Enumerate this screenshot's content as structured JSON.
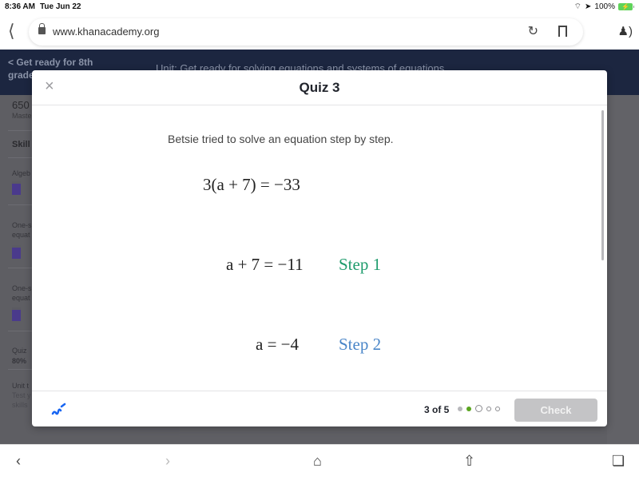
{
  "status_bar": {
    "time": "8:36 AM",
    "date": "Tue Jun 22",
    "battery": "100%"
  },
  "browser": {
    "url": "www.khanacademy.org",
    "icons": {
      "back": "chevron-left-icon",
      "lock": "lock-icon",
      "reload": "reload-icon",
      "bookmark": "bookmark-icon",
      "profile": "profile-icon"
    }
  },
  "background_page": {
    "back_link": "< Get ready for 8th grade",
    "unit_title": "Unit: Get ready for solving equations and systems of equations",
    "sidebar": {
      "score": "650",
      "score_label": "Mastery points",
      "section_heading": "Skill",
      "items": [
        {
          "label": "Algeb"
        },
        {
          "label": "One-s equat"
        },
        {
          "label": "One-s equat"
        },
        {
          "label": "Quiz",
          "sub": "80%"
        },
        {
          "label": "Unit t",
          "sub": "Test y skills"
        }
      ]
    }
  },
  "modal": {
    "title": "Quiz 3",
    "close_label": "×",
    "prompt": "Betsie tried to solve an equation step by step.",
    "equations": [
      {
        "expr": "3(a + 7) = −33",
        "step": ""
      },
      {
        "expr": "a + 7 = −11",
        "step": "Step 1",
        "step_color": "#1f9c6d"
      },
      {
        "expr": "a = −4",
        "step": "Step 2",
        "step_color": "#4a86c8"
      }
    ],
    "footer": {
      "progress_text": "3 of 5",
      "dots": [
        "done",
        "correct",
        "current",
        "pending",
        "pending"
      ],
      "check_label": "Check",
      "calculator_icon": "calculator-icon"
    }
  },
  "bottom_bar": {
    "back": "‹",
    "forward": "›",
    "home": "home-icon",
    "share": "share-icon",
    "tabs": "tabs-icon"
  }
}
